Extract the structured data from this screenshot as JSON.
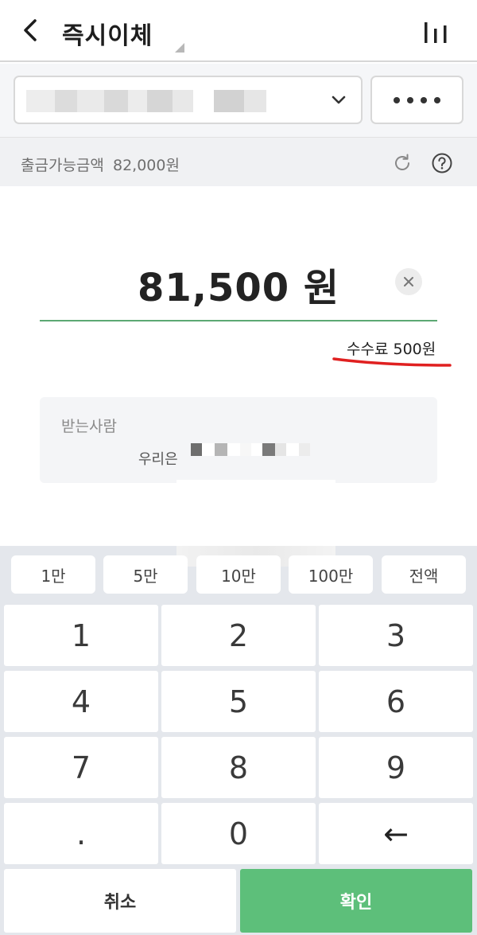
{
  "header": {
    "title": "즉시이체",
    "back_icon": "chevron-left-icon",
    "menu_icon": "bar-chart-icon"
  },
  "account": {
    "chevron_icon": "chevron-down-icon",
    "more_icon": "more-dots-icon"
  },
  "balance": {
    "label": "출금가능금액",
    "value": "82,000원",
    "refresh_icon": "refresh-icon",
    "help_icon": "help-icon"
  },
  "amount": {
    "value": "81,500 원",
    "clear_icon": "close-icon",
    "accent_color": "#5ca873"
  },
  "fee": {
    "text": "수수료 500원",
    "annotation_color": "#e02020"
  },
  "recipient": {
    "label": "받는사람",
    "bank": "우리은"
  },
  "keypad": {
    "quick_amounts": [
      "1만",
      "5만",
      "10만",
      "100만",
      "전액"
    ],
    "keys": [
      "1",
      "2",
      "3",
      "4",
      "5",
      "6",
      "7",
      "8",
      "9",
      ".",
      "0",
      "←"
    ],
    "cancel_label": "취소",
    "confirm_label": "확인",
    "confirm_color": "#5dbf7a"
  }
}
